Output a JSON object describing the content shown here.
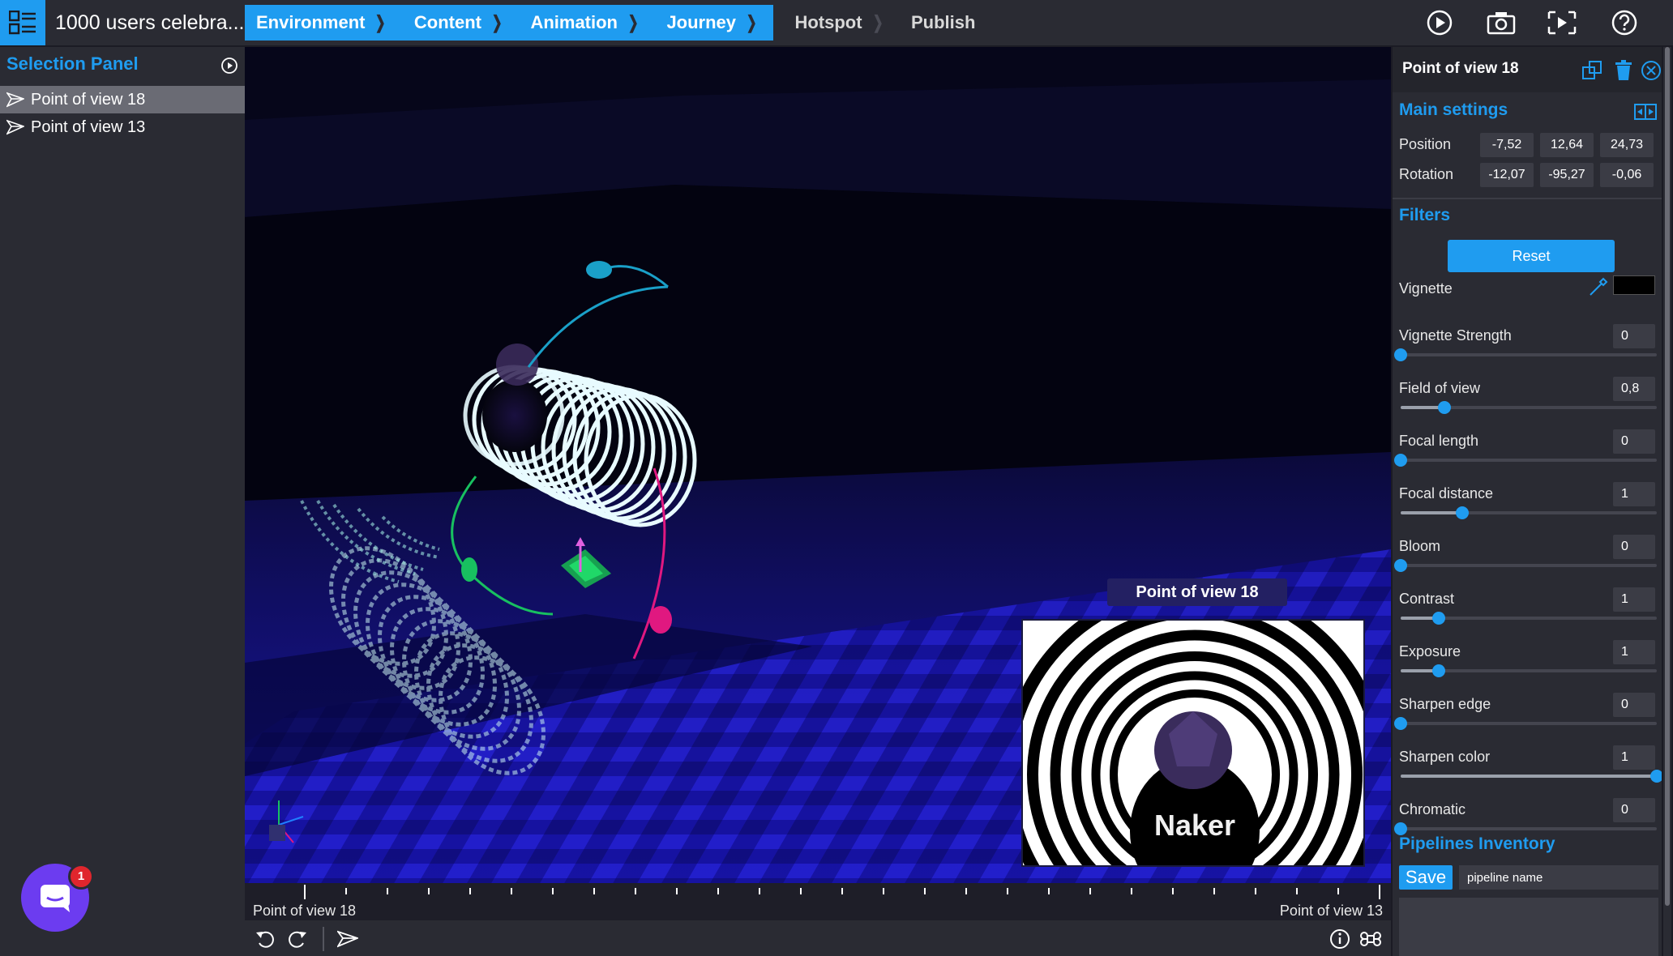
{
  "app": {
    "project_title": "1000 users celebra..."
  },
  "breadcrumbs": [
    {
      "label": "Environment",
      "active": true
    },
    {
      "label": "Content",
      "active": true
    },
    {
      "label": "Animation",
      "active": true
    },
    {
      "label": "Journey",
      "active": true
    },
    {
      "label": "Hotspot",
      "active": false
    },
    {
      "label": "Publish",
      "active": false
    }
  ],
  "top_icons": [
    "play-icon",
    "camera-icon",
    "preview-icon",
    "help-icon"
  ],
  "left_panel": {
    "title": "Selection Panel",
    "items": [
      {
        "label": "Point of view 18",
        "selected": true
      },
      {
        "label": "Point of view 13",
        "selected": false
      }
    ]
  },
  "viewport": {
    "preview_label": "Point of view 18",
    "preview_logo_text": "Naker",
    "colors": {
      "background": "#050514",
      "floor": "#1a16b0",
      "accent": "#1f9cf0"
    }
  },
  "timeline": {
    "start_label": "Point of view 18",
    "end_label": "Point of view 13"
  },
  "right_panel": {
    "title": "Point of view 18",
    "main_settings": {
      "title": "Main settings",
      "position_label": "Position",
      "position": [
        "-7,52",
        "12,64",
        "24,73"
      ],
      "rotation_label": "Rotation",
      "rotation": [
        "-12,07",
        "-95,27",
        "-0,06"
      ]
    },
    "filters": {
      "title": "Filters",
      "reset_label": "Reset",
      "vignette_label": "Vignette",
      "vignette_color": "#000000",
      "sliders": [
        {
          "label": "Vignette Strength",
          "value": "0",
          "fraction": 0.0
        },
        {
          "label": "Field of view",
          "value": "0,8",
          "fraction": 0.17
        },
        {
          "label": "Focal length",
          "value": "0",
          "fraction": 0.0
        },
        {
          "label": "Focal distance",
          "value": "1",
          "fraction": 0.24
        },
        {
          "label": "Bloom",
          "value": "0",
          "fraction": 0.0
        },
        {
          "label": "Contrast",
          "value": "1",
          "fraction": 0.15
        },
        {
          "label": "Exposure",
          "value": "1",
          "fraction": 0.15
        },
        {
          "label": "Sharpen edge",
          "value": "0",
          "fraction": 0.0
        },
        {
          "label": "Sharpen color",
          "value": "1",
          "fraction": 1.0
        },
        {
          "label": "Chromatic",
          "value": "0",
          "fraction": 0.0
        }
      ]
    },
    "pipelines": {
      "title": "Pipelines Inventory",
      "save_label": "Save",
      "input_value": "pipeline name"
    }
  },
  "chat": {
    "badge_count": "1"
  }
}
